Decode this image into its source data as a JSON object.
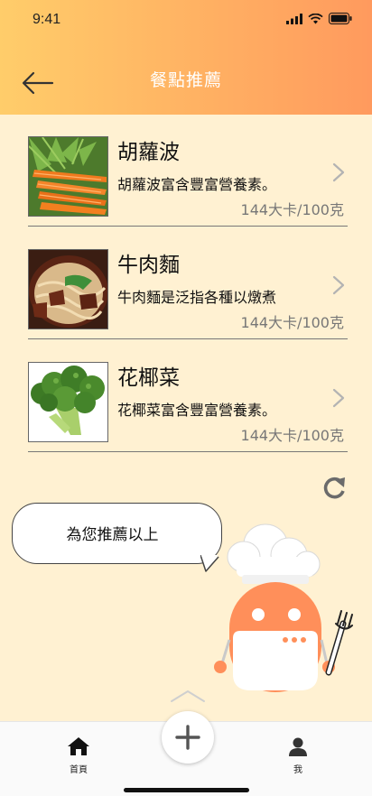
{
  "status_bar": {
    "time": "9:41"
  },
  "header": {
    "title": "餐點推薦"
  },
  "items": [
    {
      "name": "胡蘿波",
      "description": "胡蘿波富含豐富營養素。",
      "calories": "144大卡/100克",
      "image_icon": "carrot-image"
    },
    {
      "name": "牛肉麵",
      "description": "牛肉麵是泛指各種以燉煮",
      "calories": "144大卡/100克",
      "image_icon": "beef-noodle-image"
    },
    {
      "name": "花椰菜",
      "description": "花椰菜富含豐富營養素。",
      "calories": "144大卡/100克",
      "image_icon": "broccoli-image"
    }
  ],
  "assistant": {
    "message": "為您推薦以上"
  },
  "tabbar": {
    "home_label": "首頁",
    "me_label": "我"
  },
  "colors": {
    "header_start": "#ffcd6a",
    "header_end": "#ff9a5e",
    "content_bg": "#fff1d2",
    "robot": "#ff8f5a"
  }
}
